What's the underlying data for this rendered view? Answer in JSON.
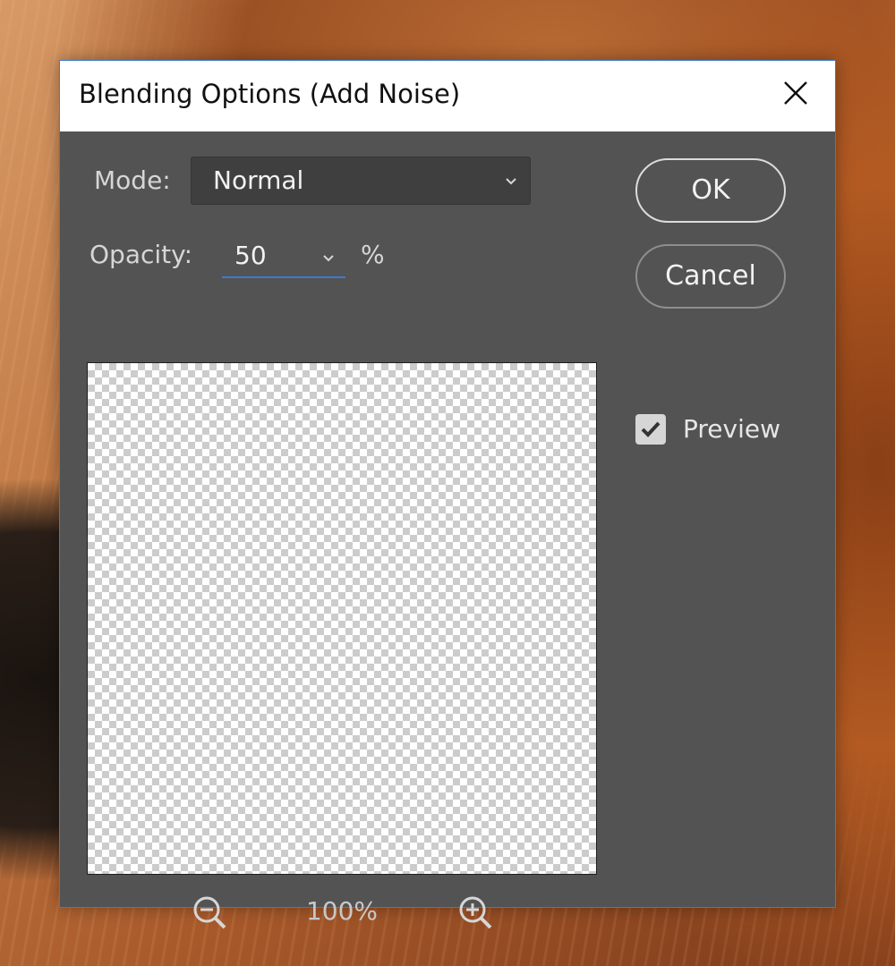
{
  "dialog": {
    "title": "Blending Options (Add Noise)",
    "mode_label": "Mode:",
    "mode_value": "Normal",
    "opacity_label": "Opacity:",
    "opacity_value": "50",
    "opacity_unit": "%",
    "ok_label": "OK",
    "cancel_label": "Cancel",
    "preview_label": "Preview",
    "preview_checked": true,
    "zoom_level": "100%"
  },
  "colors": {
    "dialog_bg": "#535353",
    "accent": "#3d7bd0",
    "title_bg": "#ffffff"
  },
  "icons": {
    "close": "close-icon",
    "mode_dropdown": "chevron-down-icon",
    "opacity_dropdown": "chevron-down-icon",
    "checkbox": "checkmark-icon",
    "zoom_out": "zoom-out-icon",
    "zoom_in": "zoom-in-icon"
  }
}
